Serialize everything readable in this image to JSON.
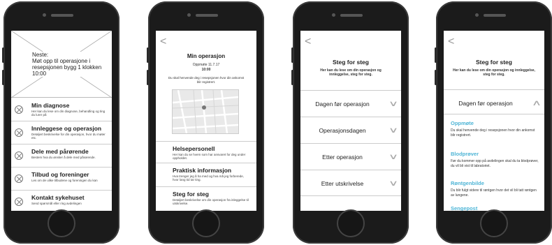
{
  "phone1": {
    "next": "Neste:\nMøt opp til operasjone i resepsjonen bygg 1 klokken 10:00",
    "items": [
      {
        "title": "Min diagnose",
        "sub": "Her kan du lese om din diagnose, behandling og ting du lurer på"
      },
      {
        "title": "Innleggese og operasjon",
        "sub": "Detaljert beskrivelse for din operasjon, hvor du møter etc."
      },
      {
        "title": "Dele med pårørende",
        "sub": "Bestem hva du ønsker å dele med pårørende."
      },
      {
        "title": "Tilbud og foreninger",
        "sub": "Les om de ulike tilbudene og foreningen du kan"
      },
      {
        "title": "Kontakt sykehuset",
        "sub": "Send spørsmål eller ring avdelingen"
      }
    ]
  },
  "phone2": {
    "back": "<",
    "title": "Min operasjon",
    "date_label": "Oppmøte 11.7.17",
    "time": "10:00",
    "info": "Du skal henvende deg i resepsjonen hvor din ankomst blir registrert.",
    "items": [
      {
        "title": "Helsepersonell",
        "sub": "Her kan du se hvem som har ansvaret for deg under oppholdet."
      },
      {
        "title": "Praktisk informasjon",
        "sub": "Hva trenger jeg å ha med og hva må jeg forberede, hvor lang tid tar ting."
      },
      {
        "title": "Steg for steg",
        "sub": "Detaljert beskrivelse om din operasjon fra inleggelse til utskrivelse."
      }
    ]
  },
  "phone3": {
    "back": "<",
    "title": "Steg for steg",
    "subtitle": "Her kan du lese om din operasjon og innleggelse, steg for steg.",
    "rows": [
      "Dagen før operasjon",
      "Operasjonsdagen",
      "Etter operasjon",
      "Etter utskrivelse"
    ]
  },
  "phone4": {
    "back": "<",
    "title": "Steg for steg",
    "subtitle": "Her kan du lese om din operasjon og innleggelse, steg for steg.",
    "expanded": "Dagen før operasjon",
    "sections": [
      {
        "heading": "Oppmøte",
        "body": "Du skal henvende deg i resepsjonen hvor din ankomst blir registrert."
      },
      {
        "heading": "Blodprøver",
        "body": "Før du kommer opp på avdelingen skal du ta blodprøver, du vil bli vist til labratoriet."
      },
      {
        "heading": "Røntgenbilde",
        "body": "Du blir fulgt videre til røntgen hvor det vil bli tatt røntgen av lungene."
      },
      {
        "heading": "Sengepost",
        "body": ""
      }
    ]
  },
  "colors": {
    "accent": "#4fb5d6",
    "frame": "#1b1b1b"
  }
}
